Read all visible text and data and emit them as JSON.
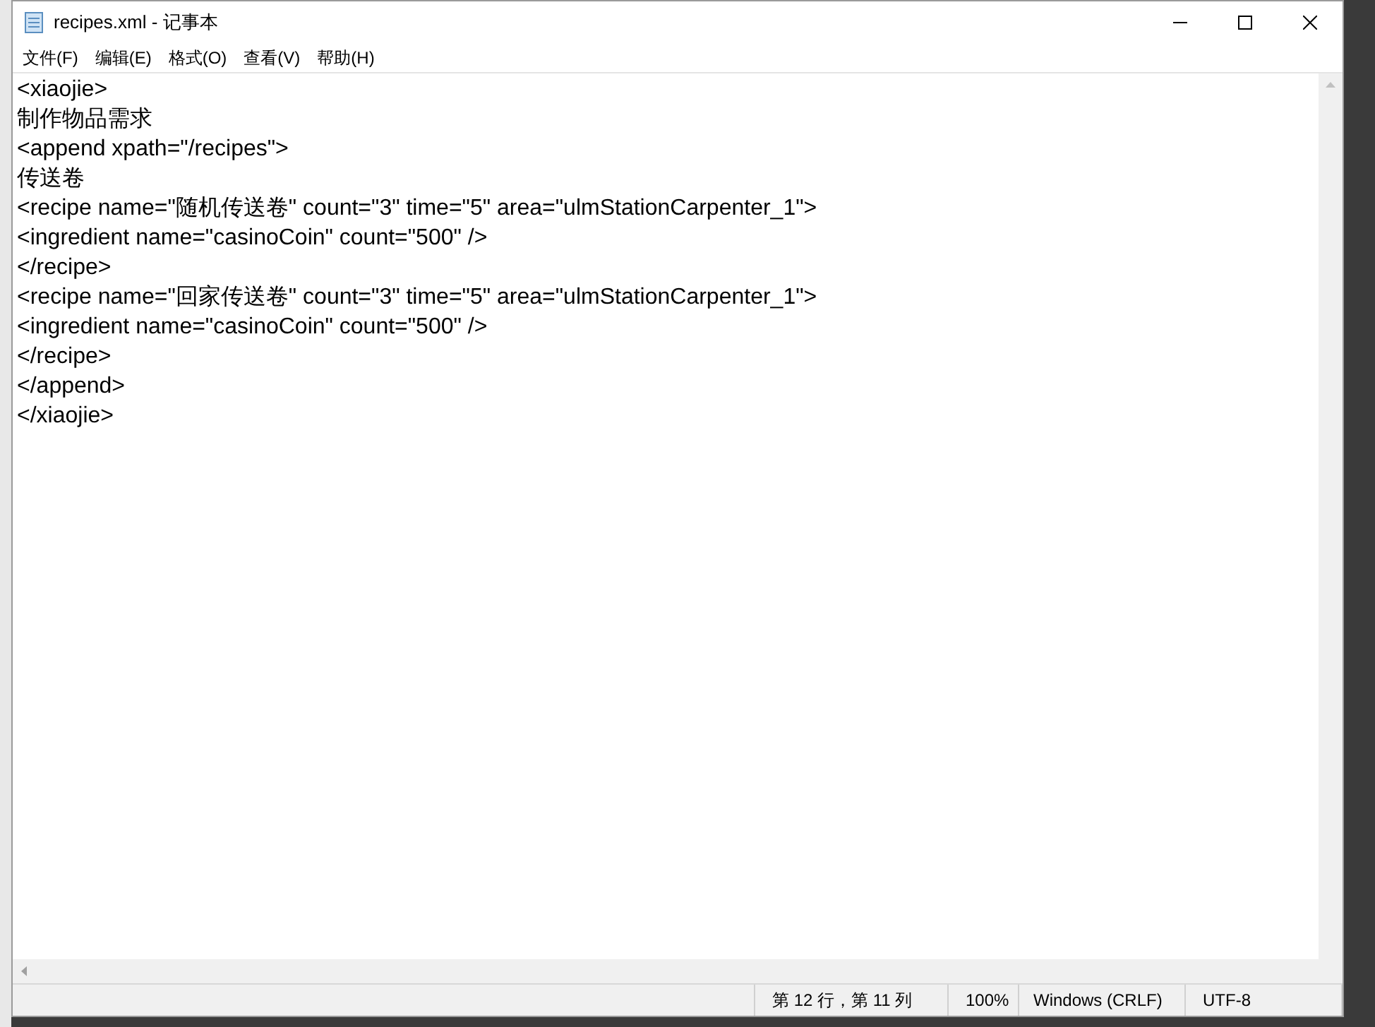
{
  "window": {
    "title": "recipes.xml - 记事本"
  },
  "menu": [
    "文件(F)",
    "编辑(E)",
    "格式(O)",
    "查看(V)",
    "帮助(H)"
  ],
  "editor": {
    "lines": [
      "<xiaojie>",
      "制作物品需求",
      "<append xpath=\"/recipes\">",
      "传送卷",
      "<recipe name=\"随机传送卷\" count=\"3\" time=\"5\" area=\"ulmStationCarpenter_1\">",
      "<ingredient name=\"casinoCoin\" count=\"500\" />",
      "</recipe>",
      "<recipe name=\"回家传送卷\" count=\"3\" time=\"5\" area=\"ulmStationCarpenter_1\">",
      "<ingredient name=\"casinoCoin\" count=\"500\" />",
      "</recipe>",
      "</append>",
      "</xiaojie>"
    ]
  },
  "status_bar": {
    "position": "第 12 行，第 11 列",
    "zoom": "100%",
    "line_ending": "Windows (CRLF)",
    "encoding": "UTF-8"
  }
}
